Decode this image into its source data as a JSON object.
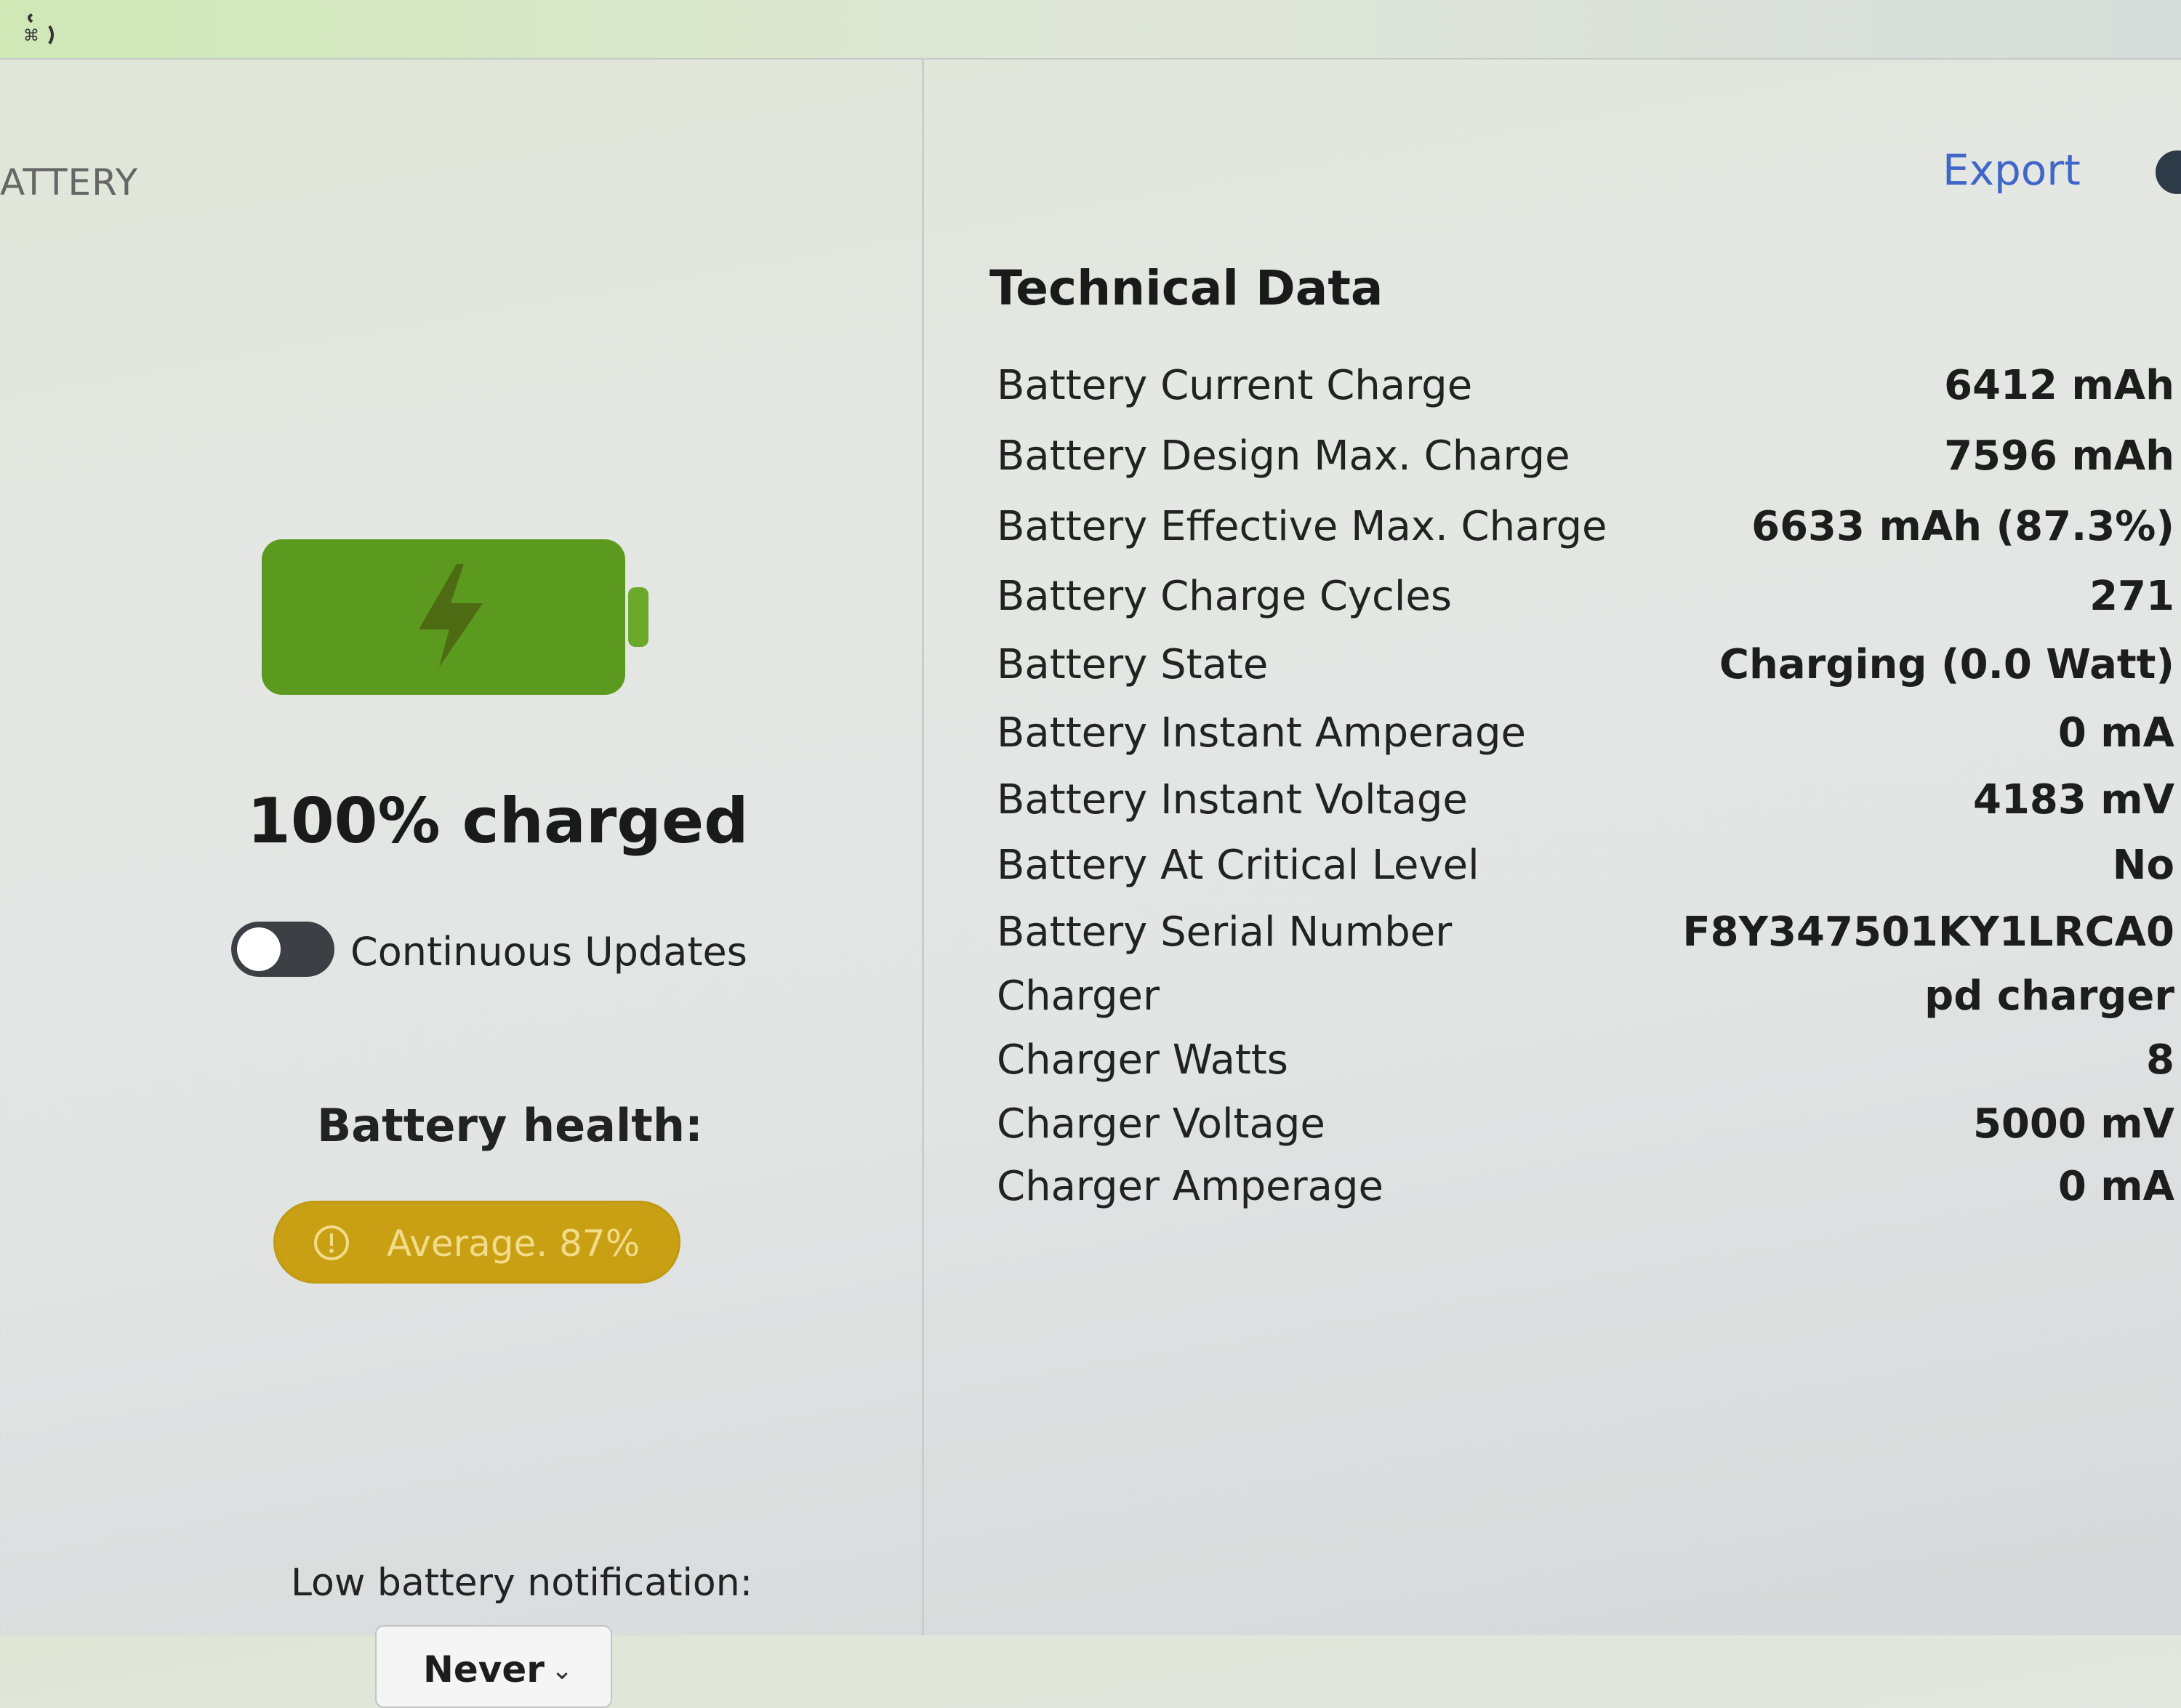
{
  "header": {
    "section_label": "ATTERY",
    "export_label": "Export"
  },
  "battery": {
    "charge_level": 1.0,
    "charged_text": "100% charged",
    "continuous_updates_label": "Continuous Updates",
    "continuous_updates_on": false,
    "health_label": "Battery health:",
    "health_badge": "Average. 87%",
    "low_battery_label": "Low battery notification:",
    "low_battery_value": "Never"
  },
  "technical": {
    "title": "Technical Data",
    "rows": [
      {
        "label": "Battery Current Charge",
        "value": "6412 mAh"
      },
      {
        "label": "Battery Design Max. Charge",
        "value": "7596 mAh"
      },
      {
        "label": "Battery Effective Max. Charge",
        "value": "6633 mAh (87.3%)"
      },
      {
        "label": "Battery Charge Cycles",
        "value": "271"
      },
      {
        "label": "Battery State",
        "value": "Charging (0.0 Watt)"
      },
      {
        "label": "Battery Instant Amperage",
        "value": "0 mA"
      },
      {
        "label": "Battery Instant Voltage",
        "value": "4183 mV"
      },
      {
        "label": "Battery At Critical Level",
        "value": "No"
      },
      {
        "label": "Battery Serial Number",
        "value": "F8Y347501KY1LRCA0"
      },
      {
        "label": "Charger",
        "value": "pd charger"
      },
      {
        "label": "Charger Watts",
        "value": "8"
      },
      {
        "label": "Charger Voltage",
        "value": "5000 mV"
      },
      {
        "label": "Charger Amperage",
        "value": "0 mA"
      }
    ]
  },
  "colors": {
    "battery_fill": "#5b9a1e",
    "bolt": "#4d6b12",
    "health_badge": "#c9a014",
    "export_link": "#3f66c8",
    "toggle_off": "#3c3f44"
  },
  "icons": [
    "app-menu-icon",
    "battery-icon",
    "charging-bolt-icon",
    "warning-circle-icon",
    "chevron-down-icon"
  ]
}
